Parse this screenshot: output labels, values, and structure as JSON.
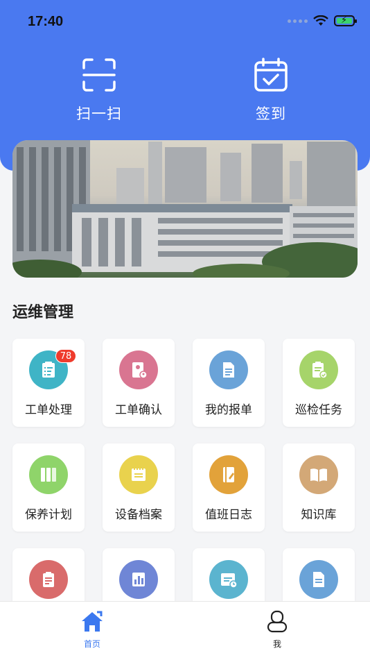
{
  "status": {
    "time": "17:40"
  },
  "quick_actions": [
    {
      "label": "扫一扫",
      "icon": "scan-icon"
    },
    {
      "label": "签到",
      "icon": "calendar-check-icon"
    }
  ],
  "banner": {
    "image": "hospital-building-photo"
  },
  "section": {
    "title": "运维管理"
  },
  "items": [
    {
      "label": "工单处理",
      "icon": "work-order-icon",
      "color": "#3fb4c6",
      "badge": "78"
    },
    {
      "label": "工单确认",
      "icon": "confirm-doc-icon",
      "color": "#d97591"
    },
    {
      "label": "我的报单",
      "icon": "my-report-icon",
      "color": "#6aa3d8"
    },
    {
      "label": "巡检任务",
      "icon": "inspection-icon",
      "color": "#a6d46a"
    },
    {
      "label": "保养计划",
      "icon": "maintenance-plan-icon",
      "color": "#8fd46a"
    },
    {
      "label": "设备档案",
      "icon": "device-archive-icon",
      "color": "#e9d24d"
    },
    {
      "label": "值班日志",
      "icon": "duty-log-icon",
      "color": "#e2a23a"
    },
    {
      "label": "知识库",
      "icon": "knowledge-book-icon",
      "color": "#d3a877"
    },
    {
      "label": "",
      "icon": "clipboard-icon",
      "color": "#d96b6b"
    },
    {
      "label": "",
      "icon": "bar-chart-icon",
      "color": "#6f86d6"
    },
    {
      "label": "",
      "icon": "schedule-icon",
      "color": "#5bb4cf"
    },
    {
      "label": "",
      "icon": "document-icon",
      "color": "#6aa3d8"
    }
  ],
  "tabbar": {
    "home": {
      "label": "首页",
      "active_color": "#3b78ef"
    },
    "me": {
      "label": "我"
    }
  }
}
